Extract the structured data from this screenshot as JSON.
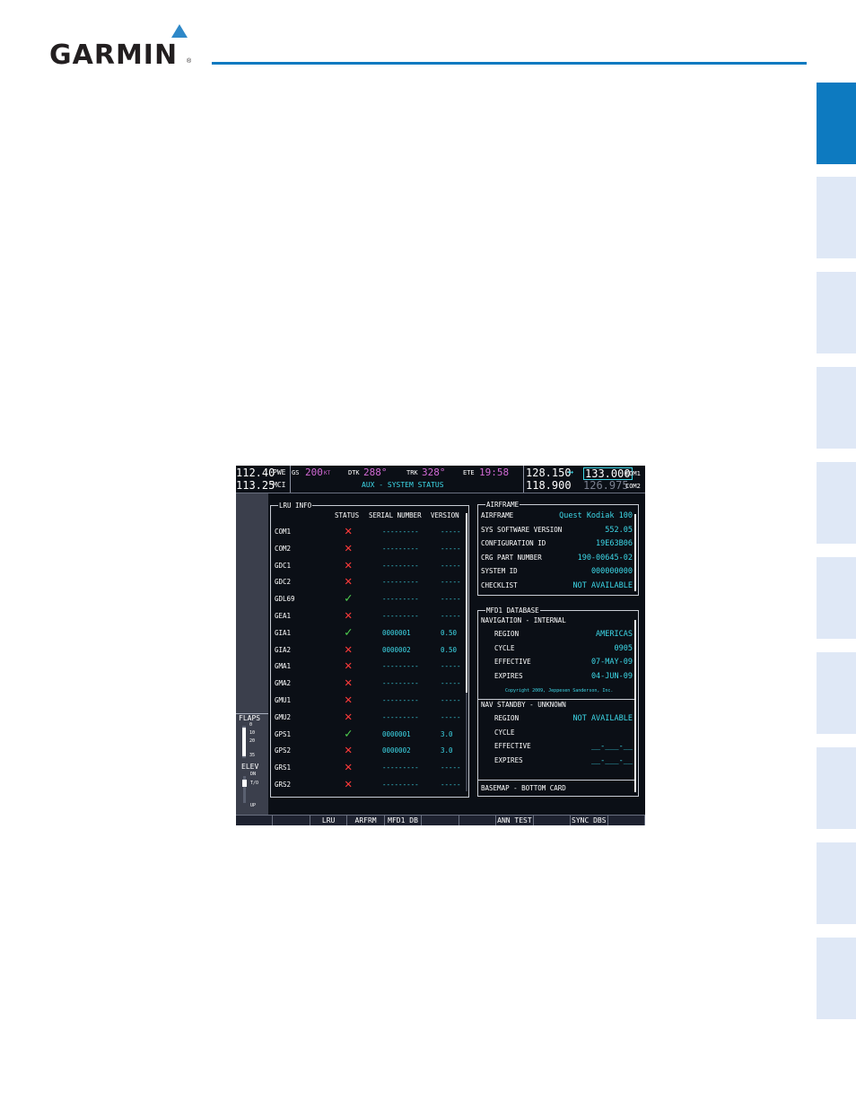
{
  "brand": {
    "name": "GARMIN",
    "reg": "®"
  },
  "nav": {
    "nav1_active": "112.40",
    "nav1_standby": "113.25",
    "nav1_id": "PWE",
    "nav2_id": "MCI",
    "gs_label": "GS",
    "gs_value": "200",
    "gs_unit": "KT",
    "dtk_label": "DTK",
    "dtk_value": "288°",
    "trk_label": "TRK",
    "trk_value": "328°",
    "ete_label": "ETE",
    "ete_value": "19:58",
    "page_title": "AUX - SYSTEM STATUS",
    "com1_active": "128.150",
    "com_swap": "↔",
    "com1_standby": "133.000",
    "com1_label": "COM1",
    "com2_active": "118.900",
    "com2_standby": "126.975",
    "com2_label": "COM2"
  },
  "lru": {
    "box_label": "LRU INFO",
    "headers": {
      "status": "STATUS",
      "serial": "SERIAL NUMBER",
      "version": "VERSION"
    },
    "rows": [
      {
        "name": "COM1",
        "status": "✕",
        "ok": false,
        "serial": "---------",
        "version": "-----"
      },
      {
        "name": "COM2",
        "status": "✕",
        "ok": false,
        "serial": "---------",
        "version": "-----"
      },
      {
        "name": "GDC1",
        "status": "✕",
        "ok": false,
        "serial": "---------",
        "version": "-----"
      },
      {
        "name": "GDC2",
        "status": "✕",
        "ok": false,
        "serial": "---------",
        "version": "-----"
      },
      {
        "name": "GDL69",
        "status": "✓",
        "ok": true,
        "serial": "---------",
        "version": "-----"
      },
      {
        "name": "GEA1",
        "status": "✕",
        "ok": false,
        "serial": "---------",
        "version": "-----"
      },
      {
        "name": "GIA1",
        "status": "✓",
        "ok": true,
        "serial": "0000001",
        "version": "0.50"
      },
      {
        "name": "GIA2",
        "status": "✕",
        "ok": false,
        "serial": "0000002",
        "version": "0.50"
      },
      {
        "name": "GMA1",
        "status": "✕",
        "ok": false,
        "serial": "---------",
        "version": "-----"
      },
      {
        "name": "GMA2",
        "status": "✕",
        "ok": false,
        "serial": "---------",
        "version": "-----"
      },
      {
        "name": "GMU1",
        "status": "✕",
        "ok": false,
        "serial": "---------",
        "version": "-----"
      },
      {
        "name": "GMU2",
        "status": "✕",
        "ok": false,
        "serial": "---------",
        "version": "-----"
      },
      {
        "name": "GPS1",
        "status": "✓",
        "ok": true,
        "serial": "0000001",
        "version": "3.0"
      },
      {
        "name": "GPS2",
        "status": "✕",
        "ok": false,
        "serial": "0000002",
        "version": "3.0"
      },
      {
        "name": "GRS1",
        "status": "✕",
        "ok": false,
        "serial": "---------",
        "version": "-----"
      },
      {
        "name": "GRS2",
        "status": "✕",
        "ok": false,
        "serial": "---------",
        "version": "-----"
      }
    ]
  },
  "airframe": {
    "box_label": "AIRFRAME",
    "rows": [
      {
        "label": "AIRFRAME",
        "value": "Quest Kodiak 100"
      },
      {
        "label": "SYS SOFTWARE VERSION",
        "value": "552.05"
      },
      {
        "label": "CONFIGURATION ID",
        "value": "19E63B06"
      },
      {
        "label": "CRG PART NUMBER",
        "value": "190-00645-02"
      },
      {
        "label": "SYSTEM ID",
        "value": "000000000"
      },
      {
        "label": "CHECKLIST",
        "value": "NOT AVAILABLE"
      }
    ]
  },
  "mfd_db": {
    "box_label": "MFD1 DATABASE",
    "nav_internal": "NAVIGATION - INTERNAL",
    "internal_rows": [
      {
        "label": "REGION",
        "value": "AMERICAS"
      },
      {
        "label": "CYCLE",
        "value": "0905"
      },
      {
        "label": "EFFECTIVE",
        "value": "07-MAY-09"
      },
      {
        "label": "EXPIRES",
        "value": "04-JUN-09"
      }
    ],
    "copyright": "Copyright 2009, Jeppesen Sanderson, Inc.",
    "nav_standby": "NAV STANDBY - UNKNOWN",
    "standby_rows": [
      {
        "label": "REGION",
        "value": "NOT AVAILABLE"
      },
      {
        "label": "CYCLE",
        "value": ""
      },
      {
        "label": "EFFECTIVE",
        "value": "__-___-__"
      },
      {
        "label": "EXPIRES",
        "value": "__-___-__"
      }
    ],
    "basemap": "BASEMAP - BOTTOM CARD"
  },
  "flaps": {
    "label": "FLAPS",
    "ticks": [
      "0",
      "10",
      "20",
      "35"
    ]
  },
  "elev": {
    "label": "ELEV",
    "dn": "DN",
    "to": "T/O",
    "up": "UP"
  },
  "softkeys": [
    "",
    "",
    "LRU",
    "ARFRM",
    "MFD1 DB",
    "",
    "",
    "ANN TEST",
    "",
    "SYNC DBS",
    ""
  ],
  "colors": {
    "accent": "#0d7ac0",
    "tab": "#dfe8f6",
    "screen_bg": "#0b0f16",
    "cyan": "#3dd8e8",
    "magenta": "#d36ad6"
  }
}
